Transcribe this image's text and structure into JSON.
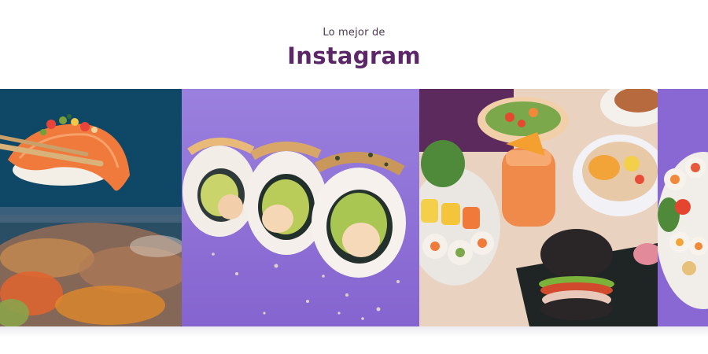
{
  "section": {
    "subtitle": "Lo mejor de",
    "title": "Instagram"
  },
  "colors": {
    "title": "#5c2766",
    "subtitle": "#4a3a4f",
    "purple_background": "#8f6fd8",
    "teal_background": "#0f4a66"
  },
  "gallery": {
    "posts": [
      {
        "subject": "salmon-nigiri-with-chopsticks"
      },
      {
        "subject": "shrimp-avocado-sushi-rolls"
      },
      {
        "subject": "table-with-salad-drink-sushi-burger"
      },
      {
        "subject": "sushi-platter-partial"
      }
    ]
  }
}
